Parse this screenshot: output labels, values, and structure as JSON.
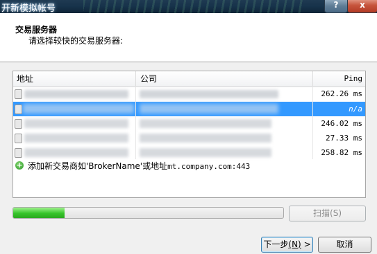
{
  "window": {
    "title": "开新模拟帐号",
    "help_label": "?",
    "close_label": "x"
  },
  "header": {
    "title": "交易服务器",
    "subtitle": "请选择较快的交易服务器:"
  },
  "table": {
    "columns": [
      "地址",
      "公司",
      "Ping"
    ],
    "rows": [
      {
        "address": "",
        "company": "",
        "ping": "262.26 ms",
        "selected": false
      },
      {
        "address": "",
        "company": "",
        "ping": "n/a",
        "selected": true
      },
      {
        "address": "",
        "company": "",
        "ping": "246.02 ms",
        "selected": false
      },
      {
        "address": "",
        "company": "",
        "ping": "27.33 ms",
        "selected": false
      },
      {
        "address": "",
        "company": "",
        "ping": "258.82 ms",
        "selected": false
      }
    ],
    "add_hint_prefix": "添加新交易商如'BrokerName'或地址",
    "add_hint_example": "mt.company.com:443"
  },
  "progress": {
    "fraction": 0.19
  },
  "buttons": {
    "scan": {
      "label": "扫描",
      "mnemonic": "(S)"
    },
    "next": {
      "label": "下一步",
      "mnemonic": "(N)",
      "arrow": ">"
    },
    "cancel": {
      "label": "取消"
    }
  },
  "colors": {
    "selection": "#3399ff",
    "progress": "#37c42b"
  }
}
